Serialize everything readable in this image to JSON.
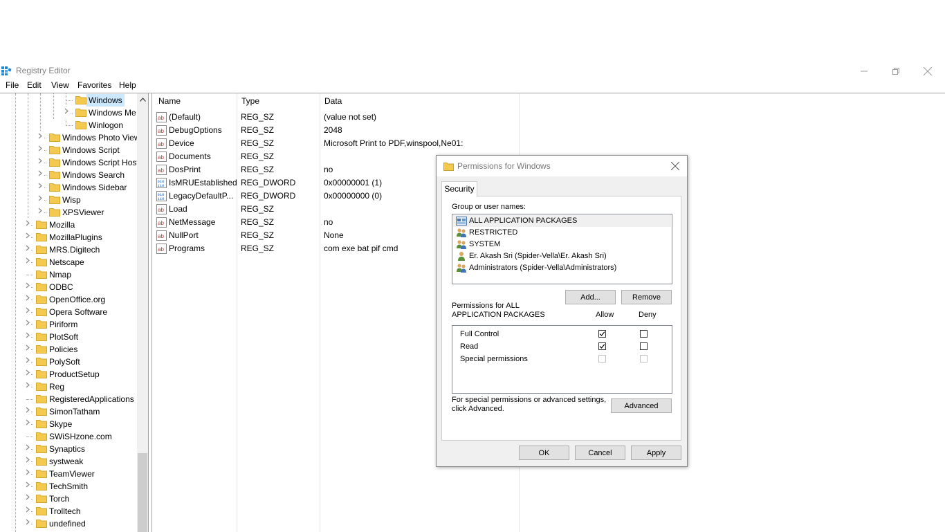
{
  "window": {
    "title": "Registry Editor",
    "controls": {
      "minimize": "—",
      "maximize": "❐",
      "close": "✕"
    }
  },
  "menu": [
    "File",
    "Edit",
    "View",
    "Favorites",
    "Help"
  ],
  "tree": {
    "items": [
      {
        "label": "Windows",
        "selected": true
      },
      {
        "label": "Windows Me"
      },
      {
        "label": "Winlogon"
      },
      {
        "label": "Windows Photo View"
      },
      {
        "label": "Windows Script"
      },
      {
        "label": "Windows Script Host"
      },
      {
        "label": "Windows Search"
      },
      {
        "label": "Windows Sidebar"
      },
      {
        "label": "Wisp"
      },
      {
        "label": "XPSViewer"
      },
      {
        "label": "Mozilla"
      },
      {
        "label": "MozillaPlugins"
      },
      {
        "label": "MRS.Digitech"
      },
      {
        "label": "Netscape"
      },
      {
        "label": "Nmap"
      },
      {
        "label": "ODBC"
      },
      {
        "label": "OpenOffice.org"
      },
      {
        "label": "Opera Software"
      },
      {
        "label": "Piriform"
      },
      {
        "label": "PlotSoft"
      },
      {
        "label": "Policies"
      },
      {
        "label": "PolySoft"
      },
      {
        "label": "ProductSetup"
      },
      {
        "label": "Reg"
      },
      {
        "label": "RegisteredApplications"
      },
      {
        "label": "SimonTatham"
      },
      {
        "label": "Skype"
      },
      {
        "label": "SWiSHzone.com"
      },
      {
        "label": "Synaptics"
      },
      {
        "label": "systweak"
      },
      {
        "label": "TeamViewer"
      },
      {
        "label": "TechSmith"
      },
      {
        "label": "Torch"
      },
      {
        "label": "Trolltech"
      },
      {
        "label": "undefined"
      }
    ]
  },
  "list": {
    "headers": {
      "name": "Name",
      "type": "Type",
      "data": "Data"
    },
    "rows": [
      {
        "name": "(Default)",
        "type": "REG_SZ",
        "data": "(value not set)",
        "icon": "string-value-icon"
      },
      {
        "name": "DebugOptions",
        "type": "REG_SZ",
        "data": "2048",
        "icon": "string-value-icon"
      },
      {
        "name": "Device",
        "type": "REG_SZ",
        "data": "Microsoft Print to PDF,winspool,Ne01:",
        "icon": "string-value-icon"
      },
      {
        "name": "Documents",
        "type": "REG_SZ",
        "data": "",
        "icon": "string-value-icon"
      },
      {
        "name": "DosPrint",
        "type": "REG_SZ",
        "data": "no",
        "icon": "string-value-icon"
      },
      {
        "name": "IsMRUEstablished",
        "type": "REG_DWORD",
        "data": "0x00000001 (1)",
        "icon": "binary-value-icon"
      },
      {
        "name": "LegacyDefaultP...",
        "type": "REG_DWORD",
        "data": "0x00000000 (0)",
        "icon": "binary-value-icon"
      },
      {
        "name": "Load",
        "type": "REG_SZ",
        "data": "",
        "icon": "string-value-icon"
      },
      {
        "name": "NetMessage",
        "type": "REG_SZ",
        "data": "no",
        "icon": "string-value-icon"
      },
      {
        "name": "NullPort",
        "type": "REG_SZ",
        "data": "None",
        "icon": "string-value-icon"
      },
      {
        "name": "Programs",
        "type": "REG_SZ",
        "data": "com exe bat pif cmd",
        "icon": "string-value-icon"
      }
    ]
  },
  "dialog": {
    "title": "Permissions for Windows",
    "tab": "Security",
    "group_label": "Group or user names:",
    "users": [
      {
        "name": "ALL APPLICATION PACKAGES",
        "icon": "app-packages-icon"
      },
      {
        "name": "RESTRICTED",
        "icon": "group-icon"
      },
      {
        "name": "SYSTEM",
        "icon": "group-icon"
      },
      {
        "name": "Er. Akash Sri (Spider-Vella\\Er. Akash Sri)",
        "icon": "user-icon"
      },
      {
        "name": "Administrators (Spider-Vella\\Administrators)",
        "icon": "group-icon"
      }
    ],
    "add_button": "Add...",
    "remove_button": "Remove",
    "perm_label_line1": "Permissions for ALL",
    "perm_label_line2": "APPLICATION PACKAGES",
    "allow_header": "Allow",
    "deny_header": "Deny",
    "permissions": [
      {
        "name": "Full Control",
        "allow": true,
        "deny": false,
        "enabled": true
      },
      {
        "name": "Read",
        "allow": true,
        "deny": false,
        "enabled": true
      },
      {
        "name": "Special permissions",
        "allow": false,
        "deny": false,
        "enabled": false
      }
    ],
    "advanced_text_line1": "For special permissions or advanced settings,",
    "advanced_text_line2": "click Advanced.",
    "advanced_button": "Advanced",
    "ok_button": "OK",
    "cancel_button": "Cancel",
    "apply_button": "Apply"
  },
  "colors": {
    "folder": "#f3c94f",
    "selection": "#cce8ff",
    "dialog_bg": "#f0f0f0",
    "accent": "#0078d7"
  }
}
